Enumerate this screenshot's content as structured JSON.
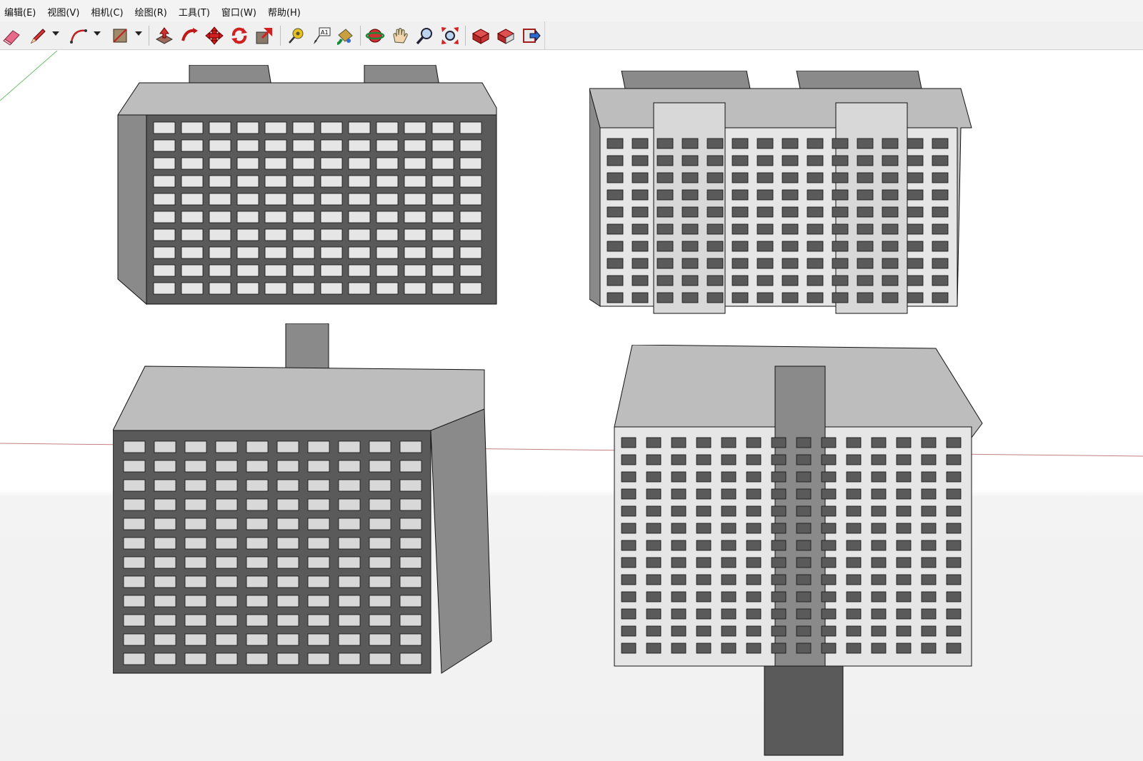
{
  "menubar": {
    "items": [
      {
        "label": "编辑(E)"
      },
      {
        "label": "视图(V)"
      },
      {
        "label": "相机(C)"
      },
      {
        "label": "绘图(R)"
      },
      {
        "label": "工具(T)"
      },
      {
        "label": "窗口(W)"
      },
      {
        "label": "帮助(H)"
      }
    ]
  },
  "toolbar": {
    "tools": [
      {
        "icon": "eraser-icon"
      },
      {
        "icon": "pencil-icon"
      },
      {
        "icon": "arc-icon"
      },
      {
        "icon": "shape-icon"
      },
      {
        "icon": "push-pull-icon"
      },
      {
        "icon": "follow-me-icon"
      },
      {
        "icon": "move-icon"
      },
      {
        "icon": "rotate-icon"
      },
      {
        "icon": "scale-icon"
      },
      {
        "icon": "tape-measure-icon"
      },
      {
        "icon": "text-label-icon",
        "label": "A1"
      },
      {
        "icon": "paint-bucket-icon"
      },
      {
        "icon": "orbit-icon"
      },
      {
        "icon": "pan-icon"
      },
      {
        "icon": "zoom-icon"
      },
      {
        "icon": "zoom-extents-icon"
      },
      {
        "icon": "warehouse-icon"
      },
      {
        "icon": "get-models-icon"
      },
      {
        "icon": "share-model-icon"
      }
    ]
  },
  "viewport": {
    "models": [
      {
        "name": "building-top-left"
      },
      {
        "name": "building-top-right"
      },
      {
        "name": "building-bottom-left"
      },
      {
        "name": "building-bottom-right"
      }
    ]
  },
  "colors": {
    "toolbar_bg": "#f0f0f0",
    "wall_dark": "#5a5a5a",
    "wall_mid": "#8a8a8a",
    "wall_light": "#e6e6e6",
    "roof": "#bdbdbd",
    "axis_red": "#c08080",
    "axis_green": "#6bbf6b"
  }
}
